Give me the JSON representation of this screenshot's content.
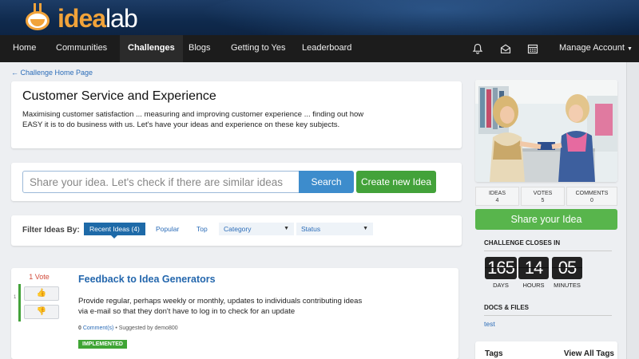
{
  "app": {
    "logo_part1": "idea",
    "logo_part2": "lab"
  },
  "nav": {
    "items": [
      "Home",
      "Communities",
      "Challenges",
      "Blogs",
      "Getting to Yes",
      "Leaderboard"
    ],
    "active": "Challenges",
    "account": "Manage Account",
    "account_caret": "▼",
    "icons": [
      "bell-icon",
      "mail-icon",
      "calendar-icon"
    ]
  },
  "breadcrumb": "← Challenge Home Page",
  "challenge": {
    "title": "Customer Service and Experience",
    "description": "Maximising customer satisfaction ... measuring and improving customer experience ... finding out how EASY it is to do business with us. Let's have your ideas and experience on these key subjects."
  },
  "search": {
    "placeholder": "Share your idea. Let's check if there are similar ideas",
    "button": "Search",
    "create": "Create new Idea"
  },
  "filter": {
    "label": "Filter Ideas By:",
    "tabs": [
      "Recent Ideas (4)",
      "Popular",
      "Top"
    ],
    "selects": [
      "Category",
      "Status"
    ],
    "caret": "▼"
  },
  "idea": {
    "rank": "1",
    "votes": "1 Vote",
    "thumb_up": "👍",
    "thumb_down": "👎",
    "title": "Feedback to Idea Generators",
    "description": "Provide regular, perhaps weekly or monthly, updates to individuals contributing ideas via e-mail so that they don't have to log in to check for an update",
    "comments_count": "0",
    "comments_label": " Comment(s)",
    "suggested_by": "• Suggested by demo800",
    "status": "IMPLEMENTED"
  },
  "sidebar": {
    "stats": [
      {
        "label": "IDEAS",
        "value": "4"
      },
      {
        "label": "VOTES",
        "value": "5"
      },
      {
        "label": "COMMENTS",
        "value": "0"
      }
    ],
    "share_button": "Share your Idea",
    "closes_label": "CHALLENGE CLOSES IN",
    "countdown": [
      {
        "value": "165",
        "unit": "DAYS"
      },
      {
        "value": "14",
        "unit": "HOURS"
      },
      {
        "value": "05",
        "unit": "MINUTES"
      }
    ],
    "docs_label": "DOCS & FILES",
    "docs": [
      "test"
    ],
    "tags_label": "Tags",
    "view_all_tags": "View All Tags"
  },
  "colors": {
    "header": "#14335a",
    "nav": "#1c1c1c",
    "accent": "#f1a33a",
    "link": "#2b6cb8",
    "green": "#43a23a",
    "blue": "#3d8ccc"
  }
}
